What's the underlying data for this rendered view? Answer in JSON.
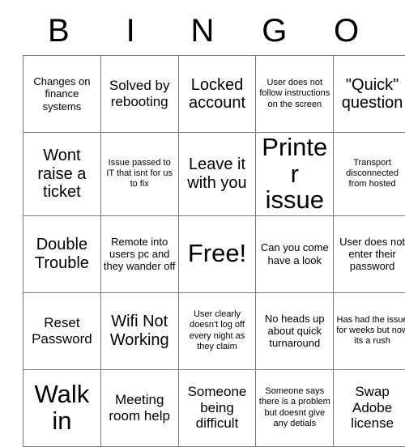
{
  "card": {
    "title": "BINGO",
    "header_letters": [
      "B",
      "I",
      "N",
      "G",
      "O"
    ],
    "columns": 5,
    "rows": 5,
    "colors": {
      "background": "#ffffff",
      "text": "#000000",
      "grid_line": "#7a7a7a"
    },
    "free_space": {
      "row": 2,
      "column": 2,
      "label": "Free!"
    },
    "cells": [
      [
        {
          "text": "Changes on finance systems",
          "size": "sz-sm"
        },
        {
          "text": "Solved by rebooting",
          "size": "sz-md"
        },
        {
          "text": "Locked account",
          "size": "sz-lg"
        },
        {
          "text": "User does not follow instructions on the screen",
          "size": "sz-xs"
        },
        {
          "text": "\"Quick\" question",
          "size": "sz-lg"
        }
      ],
      [
        {
          "text": "Wont raise a ticket",
          "size": "sz-lg"
        },
        {
          "text": "Issue passed to IT that isnt for us to fix",
          "size": "sz-xs"
        },
        {
          "text": "Leave it with you",
          "size": "sz-lg"
        },
        {
          "text": "Printer issue",
          "size": "sz-xl"
        },
        {
          "text": "Transport disconnected from hosted",
          "size": "sz-xs"
        }
      ],
      [
        {
          "text": "Double Trouble",
          "size": "sz-lg"
        },
        {
          "text": "Remote into users pc and they wander off",
          "size": "sz-sm"
        },
        {
          "text": "Free!",
          "size": "sz-xl"
        },
        {
          "text": "Can you come have a look",
          "size": "sz-sm"
        },
        {
          "text": "User does not enter their password",
          "size": "sz-sm"
        }
      ],
      [
        {
          "text": "Reset Password",
          "size": "sz-md"
        },
        {
          "text": "Wifi Not Working",
          "size": "sz-lg"
        },
        {
          "text": "User clearly doesn't log off every night as they claim",
          "size": "sz-xs"
        },
        {
          "text": "No heads up about quick turnaround",
          "size": "sz-sm"
        },
        {
          "text": "Has had the issue for weeks but now its a rush",
          "size": "sz-xs"
        }
      ],
      [
        {
          "text": "Walk in",
          "size": "sz-xl"
        },
        {
          "text": "Meeting room help",
          "size": "sz-md"
        },
        {
          "text": "Someone being difficult",
          "size": "sz-md"
        },
        {
          "text": "Someone says there is a problem but doesnt give any detials",
          "size": "sz-xs"
        },
        {
          "text": "Swap Adobe license",
          "size": "sz-md"
        }
      ]
    ]
  }
}
